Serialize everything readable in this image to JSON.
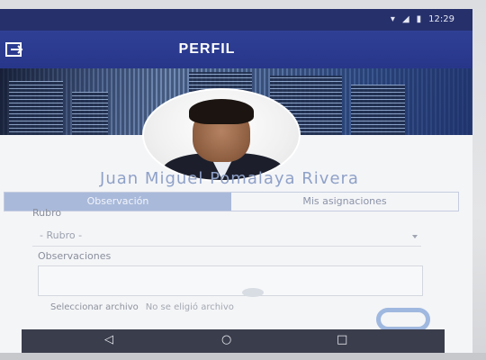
{
  "status_bar": {
    "time": "12:29",
    "icons": [
      "wifi-icon",
      "signal-icon",
      "battery-icon"
    ]
  },
  "app_bar": {
    "title": "PERFIL",
    "left_icon": "exit-icon"
  },
  "profile": {
    "name": "Juan Miguel Pomalaya Rivera"
  },
  "tabs": [
    {
      "label": "Observación",
      "active": true
    },
    {
      "label": "Mis asignaciones",
      "active": false
    }
  ],
  "form": {
    "rubro_label": "Rubro",
    "rubro_value": "- Rubro -",
    "observaciones_placeholder": "Observaciones",
    "file_button": "Seleccionar archivo",
    "file_status": "No se eligió archivo"
  },
  "nav": {
    "back": "◁",
    "home": "○",
    "recents": "□"
  },
  "colors": {
    "app_bar": "#2f4094",
    "status_bar": "#26306b",
    "tab_active": "#a9b9da",
    "fab_ring": "#9fb8df"
  }
}
